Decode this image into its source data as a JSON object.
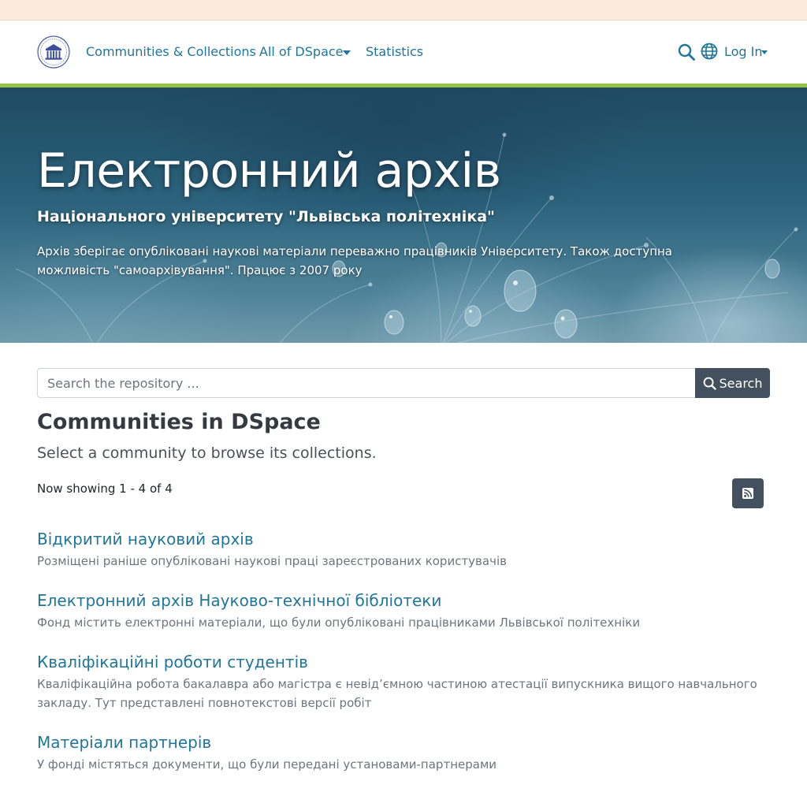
{
  "navbar": {
    "communities_label": "Communities & Collections",
    "all_dspace_label": "All of DSpace",
    "statistics_label": "Statistics",
    "login_label": "Log In",
    "logo_icon": "university-logo-icon",
    "search_icon": "search-icon",
    "language_icon": "globe-icon"
  },
  "hero": {
    "title": "Електронний архів",
    "subtitle": "Національного університету \"Львівська політехніка\"",
    "description": "Архів зберігає опубліковані наукові матеріали переважно працівників Університету. Також доступна можливість \"самоархівування\". Працює з 2007 року"
  },
  "search": {
    "placeholder": "Search the repository ...",
    "button_label": "Search"
  },
  "communities_section": {
    "title": "Communities in DSpace",
    "lead": "Select a community to browse its collections.",
    "showing_text": "Now showing 1 - 4 of 4",
    "rss_icon": "rss-icon"
  },
  "communities": [
    {
      "title": "Відкритий науковий архів",
      "description": "Розміщені раніше опубліковані наукові праці зареєстрованих користувачів"
    },
    {
      "title": "Електронний архів Науково-технічної бібліотеки",
      "description": "Фонд містить електронні матеріали, що були опубліковані працівниками Львівської політехніки"
    },
    {
      "title": "Кваліфікаційні роботи студентів",
      "description": "Кваліфікаційна робота бакалавра або магістра є невід’ємною частиною атестації випускника вищого навчального закладу. Тут представлені повнотекстові версії робіт"
    },
    {
      "title": "Матеріали партнерів",
      "description": "У фонді містяться документи, що були передані установами-партнерами"
    }
  ],
  "colors": {
    "link": "#207698",
    "accent_bar": "#92c642",
    "top_banner": "#fbeadb",
    "button": "#43515f"
  }
}
